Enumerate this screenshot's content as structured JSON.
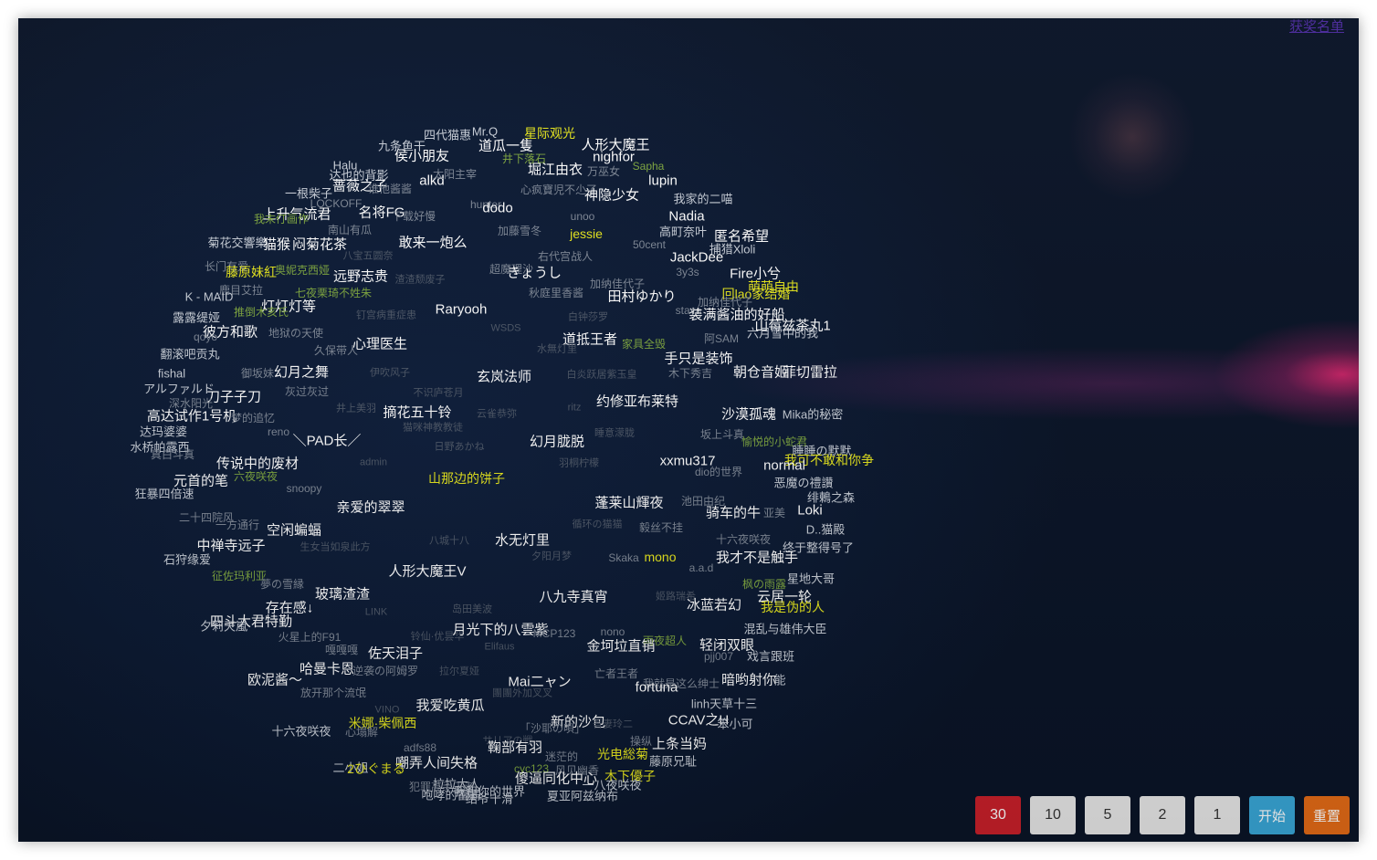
{
  "top_link": "获奖名单",
  "buttons": {
    "n30": "30",
    "n10": "10",
    "n5": "5",
    "n2": "2",
    "n1": "1",
    "start": "开始",
    "reset": "重置"
  },
  "colors": {
    "background": "#0c1a33",
    "highlight_yellow": "#e6e61e",
    "highlight_green": "#7ea640",
    "button_active": "#c9202a",
    "button_start": "#39a7d8",
    "button_reset": "#e46b16"
  },
  "tags": [
    {
      "t": "Mr.Q",
      "c": "t2"
    },
    {
      "t": "四代猫惠",
      "c": "t2"
    },
    {
      "t": "星际观光",
      "c": "ty"
    },
    {
      "t": "人形大魔王",
      "c": "t1"
    },
    {
      "t": "九条鱼干",
      "c": "t2"
    },
    {
      "t": "道瓜一隻",
      "c": "t1"
    },
    {
      "t": "侯小朋友",
      "c": "t1"
    },
    {
      "t": "井下落石",
      "c": "tg"
    },
    {
      "t": "nighfor",
      "c": "t1"
    },
    {
      "t": "Halu",
      "c": "t2"
    },
    {
      "t": "堀江由衣",
      "c": "t1"
    },
    {
      "t": "万巫女",
      "c": "t3"
    },
    {
      "t": "Sapha",
      "c": "tg"
    },
    {
      "t": "达也的背影",
      "c": "t2"
    },
    {
      "t": "alkd",
      "c": "t1"
    },
    {
      "t": "太阳主宰",
      "c": "t3"
    },
    {
      "t": "lupin",
      "c": "t1"
    },
    {
      "t": "一根柴子",
      "c": "t2"
    },
    {
      "t": "蔷薇之子",
      "c": "t1"
    },
    {
      "t": "谁他酱酱",
      "c": "t3"
    },
    {
      "t": "心疯寶児不尐了",
      "c": "t3"
    },
    {
      "t": "神隐少女",
      "c": "t1"
    },
    {
      "t": "我家的二喵",
      "c": "t2"
    },
    {
      "t": "LOCKOFF",
      "c": "t3"
    },
    {
      "t": "hunter",
      "c": "t3"
    },
    {
      "t": "dodo",
      "c": "t1"
    },
    {
      "t": "上升气流君",
      "c": "t1"
    },
    {
      "t": "名将FG",
      "c": "t1"
    },
    {
      "t": "下载好慢",
      "c": "t3"
    },
    {
      "t": "unoo",
      "c": "t3"
    },
    {
      "t": "Nadia",
      "c": "t1"
    },
    {
      "t": "我末仃画作",
      "c": "tg"
    },
    {
      "t": "南山有瓜",
      "c": "t3"
    },
    {
      "t": "加藤雪冬",
      "c": "t3"
    },
    {
      "t": "高町奈叶",
      "c": "t2"
    },
    {
      "t": "匿名希望",
      "c": "t1"
    },
    {
      "t": "jessie",
      "c": "ty"
    },
    {
      "t": "菊花交響樂",
      "c": "t2"
    },
    {
      "t": "猫猴",
      "c": "t1"
    },
    {
      "t": "闷菊花茶",
      "c": "t1"
    },
    {
      "t": "敢来一炮么",
      "c": "t1"
    },
    {
      "t": "50cent",
      "c": "t3"
    },
    {
      "t": "捕猎Xloli",
      "c": "t2"
    },
    {
      "t": "八宝五圆奈",
      "c": "t4"
    },
    {
      "t": "右代宫战人",
      "c": "t3"
    },
    {
      "t": "JackDee",
      "c": "t1"
    },
    {
      "t": "长门有爱",
      "c": "t3"
    },
    {
      "t": "藤原妹紅",
      "c": "ty"
    },
    {
      "t": "奥妮克西娅",
      "c": "tg"
    },
    {
      "t": "超魔理沙",
      "c": "t3"
    },
    {
      "t": "きょうし",
      "c": "t1"
    },
    {
      "t": "3y3s",
      "c": "t3"
    },
    {
      "t": "Fire小兮",
      "c": "t1"
    },
    {
      "t": "远野志贵",
      "c": "t1"
    },
    {
      "t": "渣渣颓废子",
      "c": "t4"
    },
    {
      "t": "加纳佳代子",
      "c": "t3"
    },
    {
      "t": "萌萌自由",
      "c": "ty"
    },
    {
      "t": "鹿目艾拉",
      "c": "t3"
    },
    {
      "t": "七夜栗琦不姓朱",
      "c": "tg"
    },
    {
      "t": "秋庭里香酱",
      "c": "t3"
    },
    {
      "t": "田村ゆかり",
      "c": "t1"
    },
    {
      "t": "回lao家结婚",
      "c": "ty"
    },
    {
      "t": "K - MAID",
      "c": "t2"
    },
    {
      "t": "加纳佳代子",
      "c": "t3"
    },
    {
      "t": "灯灯灯等",
      "c": "t1"
    },
    {
      "t": "推倒木亥氏",
      "c": "tg"
    },
    {
      "t": "Raryooh",
      "c": "t1"
    },
    {
      "t": "staya",
      "c": "t3"
    },
    {
      "t": "装满酱油的好船",
      "c": "t1"
    },
    {
      "t": "露露缇娅",
      "c": "t2"
    },
    {
      "t": "钉宫病重症患",
      "c": "t4"
    },
    {
      "t": "白钟莎罗",
      "c": "t4"
    },
    {
      "t": "山莓兹茶丸1",
      "c": "t1"
    },
    {
      "t": "彼方和歌",
      "c": "t1"
    },
    {
      "t": "地狱の天使",
      "c": "t3"
    },
    {
      "t": "WSDS",
      "c": "t4"
    },
    {
      "t": "六月雪中的我",
      "c": "t2"
    },
    {
      "t": "qoyo",
      "c": "t3"
    },
    {
      "t": "心理医生",
      "c": "t1"
    },
    {
      "t": "道抵王者",
      "c": "t1"
    },
    {
      "t": "家具全毁",
      "c": "tg"
    },
    {
      "t": "阿SAM",
      "c": "t3"
    },
    {
      "t": "翻滚吧贡丸",
      "c": "t2"
    },
    {
      "t": "久保带人",
      "c": "t3"
    },
    {
      "t": "水無灯里",
      "c": "t4"
    },
    {
      "t": "手只是装饰",
      "c": "t1"
    },
    {
      "t": "fishal",
      "c": "t2"
    },
    {
      "t": "御坂妹",
      "c": "t3"
    },
    {
      "t": "幻月之舞",
      "c": "t1"
    },
    {
      "t": "伊吹风子",
      "c": "t4"
    },
    {
      "t": "玄岚法师",
      "c": "t1"
    },
    {
      "t": "白炎跃居紫玉皇",
      "c": "t4"
    },
    {
      "t": "木下秀吉",
      "c": "t3"
    },
    {
      "t": "朝仓音姬",
      "c": "t1"
    },
    {
      "t": "菲切雷拉",
      "c": "t1"
    },
    {
      "t": "アルファルド",
      "c": "t2"
    },
    {
      "t": "灰过灰过",
      "c": "t3"
    },
    {
      "t": "刀子子刀",
      "c": "t1"
    },
    {
      "t": "不识庐苍月",
      "c": "t4"
    },
    {
      "t": "约修亚布莱特",
      "c": "t1"
    },
    {
      "t": "深水阳光",
      "c": "t3"
    },
    {
      "t": "井上美羽",
      "c": "t4"
    },
    {
      "t": "摘花五十铃",
      "c": "t1"
    },
    {
      "t": "ritz",
      "c": "t4"
    },
    {
      "t": "沙漠孤魂",
      "c": "t1"
    },
    {
      "t": "Mika的秘密",
      "c": "t2"
    },
    {
      "t": "高达试作1号机",
      "c": "t1"
    },
    {
      "t": "梦的追忆",
      "c": "t3"
    },
    {
      "t": "云雀恭弥",
      "c": "t4"
    },
    {
      "t": "达玛婆婆",
      "c": "t2"
    },
    {
      "t": "reno",
      "c": "t3"
    },
    {
      "t": "猫咪神教教徒",
      "c": "t4"
    },
    {
      "t": "睡意濛胧",
      "c": "t4"
    },
    {
      "t": "坂上斗真",
      "c": "t3"
    },
    {
      "t": "水桥帕露西",
      "c": "t2"
    },
    {
      "t": "＼PAD长／",
      "c": "t1"
    },
    {
      "t": "日野あかね",
      "c": "t4"
    },
    {
      "t": "幻月胧脱",
      "c": "t1"
    },
    {
      "t": "愉悦的小蛇君",
      "c": "tg"
    },
    {
      "t": "睡睡の默默",
      "c": "t2"
    },
    {
      "t": "真白斗真",
      "c": "t3"
    },
    {
      "t": "admin",
      "c": "t4"
    },
    {
      "t": "羽桐柠檬",
      "c": "t4"
    },
    {
      "t": "xxmu317",
      "c": "t1"
    },
    {
      "t": "我可不敢和你争",
      "c": "ty"
    },
    {
      "t": "传说中的废材",
      "c": "t1"
    },
    {
      "t": "六夜咲夜",
      "c": "tg"
    },
    {
      "t": "dio的世界",
      "c": "t3"
    },
    {
      "t": "normal",
      "c": "t1"
    },
    {
      "t": "元首的笔",
      "c": "t1"
    },
    {
      "t": "山那边的饼子",
      "c": "ty"
    },
    {
      "t": "恶魔の禮讚",
      "c": "t2"
    },
    {
      "t": "snoopy",
      "c": "t3"
    },
    {
      "t": "狂暴四倍速",
      "c": "t2"
    },
    {
      "t": "绯鶇之森",
      "c": "t2"
    },
    {
      "t": "亲爱的翠翠",
      "c": "t1"
    },
    {
      "t": "蓬莱山輝夜",
      "c": "t1"
    },
    {
      "t": "池田由纪",
      "c": "t3"
    },
    {
      "t": "骑车的牛",
      "c": "t1"
    },
    {
      "t": "亚美",
      "c": "t3"
    },
    {
      "t": "Loki",
      "c": "t1"
    },
    {
      "t": "二十四院风",
      "c": "t3"
    },
    {
      "t": "一方通行",
      "c": "t3"
    },
    {
      "t": "空闲蝙蝠",
      "c": "t1"
    },
    {
      "t": "循环の猫猫",
      "c": "t4"
    },
    {
      "t": "毅丝不挂",
      "c": "t3"
    },
    {
      "t": "D..猫殿",
      "c": "t2"
    },
    {
      "t": "八城十八",
      "c": "t4"
    },
    {
      "t": "水无灯里",
      "c": "t1"
    },
    {
      "t": "十六夜咲夜",
      "c": "t3"
    },
    {
      "t": "终于整得号了",
      "c": "t2"
    },
    {
      "t": "中禅寺远子",
      "c": "t1"
    },
    {
      "t": "生女当如泉此方",
      "c": "t4"
    },
    {
      "t": "mono",
      "c": "ty"
    },
    {
      "t": "我才不是触手",
      "c": "t1"
    },
    {
      "t": "石狩缘爱",
      "c": "t2"
    },
    {
      "t": "Skaka",
      "c": "t3"
    },
    {
      "t": "夕阳月梦",
      "c": "t4"
    },
    {
      "t": "a.a.d",
      "c": "t3"
    },
    {
      "t": "枫の雨露",
      "c": "tg"
    },
    {
      "t": "星地大哥",
      "c": "t2"
    },
    {
      "t": "征佐玛利亚",
      "c": "tg"
    },
    {
      "t": "人形大魔王V",
      "c": "t1"
    },
    {
      "t": "玻璃渣渣",
      "c": "t1"
    },
    {
      "t": "八九寺真宵",
      "c": "t1"
    },
    {
      "t": "姬路瑞希",
      "c": "t4"
    },
    {
      "t": "云居一轮",
      "c": "t1"
    },
    {
      "t": "夢の雪縁",
      "c": "t3"
    },
    {
      "t": "冰蓝若幻",
      "c": "t1"
    },
    {
      "t": "我是伪的人",
      "c": "ty"
    },
    {
      "t": "存在感↓",
      "c": "t1"
    },
    {
      "t": "LINK",
      "c": "t4"
    },
    {
      "t": "岛田美波",
      "c": "t4"
    },
    {
      "t": "四斗大君特勤",
      "c": "t1"
    },
    {
      "t": "混乱与雄伟大臣",
      "c": "t2"
    },
    {
      "t": "夕莉天嵐",
      "c": "t2"
    },
    {
      "t": "月光下的八雲紫",
      "c": "t1"
    },
    {
      "t": "MCP123",
      "c": "t3"
    },
    {
      "t": "nono",
      "c": "t3"
    },
    {
      "t": "雨夜超人",
      "c": "tg"
    },
    {
      "t": "轻闭双眼",
      "c": "t1"
    },
    {
      "t": "火星上的F91",
      "c": "t3"
    },
    {
      "t": "铃仙·优昙华",
      "c": "t4"
    },
    {
      "t": "金坷垃直销",
      "c": "t1"
    },
    {
      "t": "pjj007",
      "c": "t3"
    },
    {
      "t": "戏言跟班",
      "c": "t2"
    },
    {
      "t": "嘎嘎嘎",
      "c": "t3"
    },
    {
      "t": "佐天泪子",
      "c": "t1"
    },
    {
      "t": "Elifaus",
      "c": "t4"
    },
    {
      "t": "哈曼卡恩",
      "c": "t1"
    },
    {
      "t": "逆袭の阿姆罗",
      "c": "t3"
    },
    {
      "t": "拉尔夏娅",
      "c": "t4"
    },
    {
      "t": "亡者王者",
      "c": "t3"
    },
    {
      "t": "暗哟射你",
      "c": "t1"
    },
    {
      "t": "能",
      "c": "t2"
    },
    {
      "t": "欧泥酱～",
      "c": "t1"
    },
    {
      "t": "Mai二ャン",
      "c": "t1"
    },
    {
      "t": "我就是这么绅士",
      "c": "t3"
    },
    {
      "t": "fortuna",
      "c": "t1"
    },
    {
      "t": "放开那个流氓",
      "c": "t3"
    },
    {
      "t": "團團外加叉叉",
      "c": "t4"
    },
    {
      "t": "linh天草十三",
      "c": "t2"
    },
    {
      "t": "VINO",
      "c": "t4"
    },
    {
      "t": "我爱吃黄瓜",
      "c": "t1"
    },
    {
      "t": "米娜·柴佩西",
      "c": "ty"
    },
    {
      "t": "新的沙包",
      "c": "t1"
    },
    {
      "t": "CCAV之H",
      "c": "t1"
    },
    {
      "t": "笨小可",
      "c": "t2"
    },
    {
      "t": "十六夜咲夜",
      "c": "t2"
    },
    {
      "t": "心塌解",
      "c": "t3"
    },
    {
      "t": "「沙耶の唄」",
      "c": "t3"
    },
    {
      "t": "吾妻玲二",
      "c": "t4"
    },
    {
      "t": "操纵",
      "c": "t3"
    },
    {
      "t": "上条当妈",
      "c": "t1"
    },
    {
      "t": "adfs88",
      "c": "t3"
    },
    {
      "t": "サリアの戦",
      "c": "t4"
    },
    {
      "t": "鞠部有羽",
      "c": "t1"
    },
    {
      "t": "迷茫的",
      "c": "t3"
    },
    {
      "t": "光电総菊",
      "c": "ty"
    },
    {
      "t": "藤原兄耻",
      "c": "t2"
    },
    {
      "t": "二小姐",
      "c": "t2"
    },
    {
      "t": "嘲弄人间失格",
      "c": "t1"
    },
    {
      "t": "2ひぐまる",
      "c": "ty"
    },
    {
      "t": "cyc123",
      "c": "tg"
    },
    {
      "t": "风见幽香",
      "c": "t3"
    },
    {
      "t": "木下優子",
      "c": "ty"
    },
    {
      "t": "拉拉大人",
      "c": "t2"
    },
    {
      "t": "傻逼同化中心",
      "c": "t1"
    },
    {
      "t": "犯罪高手王者",
      "c": "t3"
    },
    {
      "t": "我和你的世界",
      "c": "t2"
    },
    {
      "t": "一八夜咲夜",
      "c": "t2"
    },
    {
      "t": "咆哮的雷霸",
      "c": "t2"
    },
    {
      "t": "结爷十滑",
      "c": "t2"
    },
    {
      "t": "夏亚阿兹纳布",
      "c": "t2"
    }
  ]
}
